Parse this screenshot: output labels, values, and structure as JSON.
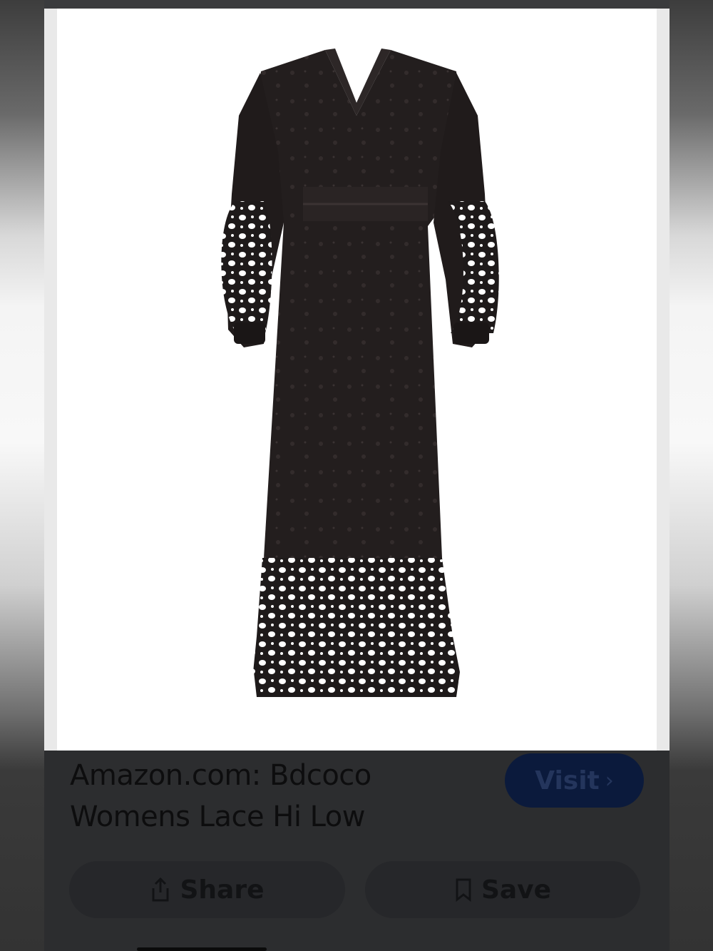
{
  "result": {
    "image_alt": "Black long-sleeve lace maxi dress",
    "title": "Amazon.com: Bdcoco Womens Lace Hi Low",
    "visit_label": "Visit",
    "visit_icon": "chevron-right-icon"
  },
  "actions": {
    "share_label": "Share",
    "share_icon": "share-icon",
    "save_label": "Save",
    "save_icon": "bookmark-icon"
  },
  "colors": {
    "overlay": "#2f3032",
    "visit_bg": "#0b1a3c",
    "action_bg": "#26272a",
    "dress": "#1e1a1a"
  }
}
